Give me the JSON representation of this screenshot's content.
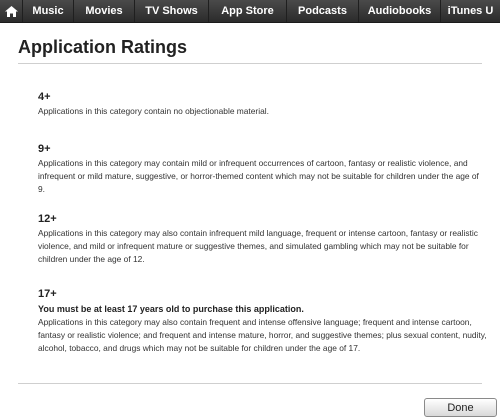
{
  "nav": {
    "home_icon": "home-icon",
    "items": [
      "Music",
      "Movies",
      "TV Shows",
      "App Store",
      "Podcasts",
      "Audiobooks",
      "iTunes U"
    ]
  },
  "page": {
    "title": "Application Ratings"
  },
  "ratings": [
    {
      "label": "4+",
      "description": "Applications in this category contain no objectionable material."
    },
    {
      "label": "9+",
      "description": "Applications in this category may contain mild or infrequent occurrences of cartoon, fantasy or realistic violence, and infrequent or mild mature, suggestive, or horror-themed content which may not be suitable for children under the age of 9."
    },
    {
      "label": "12+",
      "description": "Applications in this category may also contain infrequent mild language, frequent or intense cartoon, fantasy or realistic violence, and mild or infrequent mature or suggestive themes, and simulated gambling which may not be suitable for children under the age of 12."
    },
    {
      "label": "17+",
      "warning": "You must be at least 17 years old to purchase this application.",
      "description": "Applications in this category may also contain frequent and intense offensive language; frequent and intense cartoon, fantasy or realistic violence; and frequent and intense mature, horror, and suggestive themes; plus sexual content, nudity, alcohol, tobacco, and drugs which may not be suitable for children under the age of 17."
    }
  ],
  "footer": {
    "done_label": "Done"
  },
  "colors": {
    "navbar": "#2b2b2b",
    "text": "#333333",
    "rule": "#cfcfcf"
  }
}
